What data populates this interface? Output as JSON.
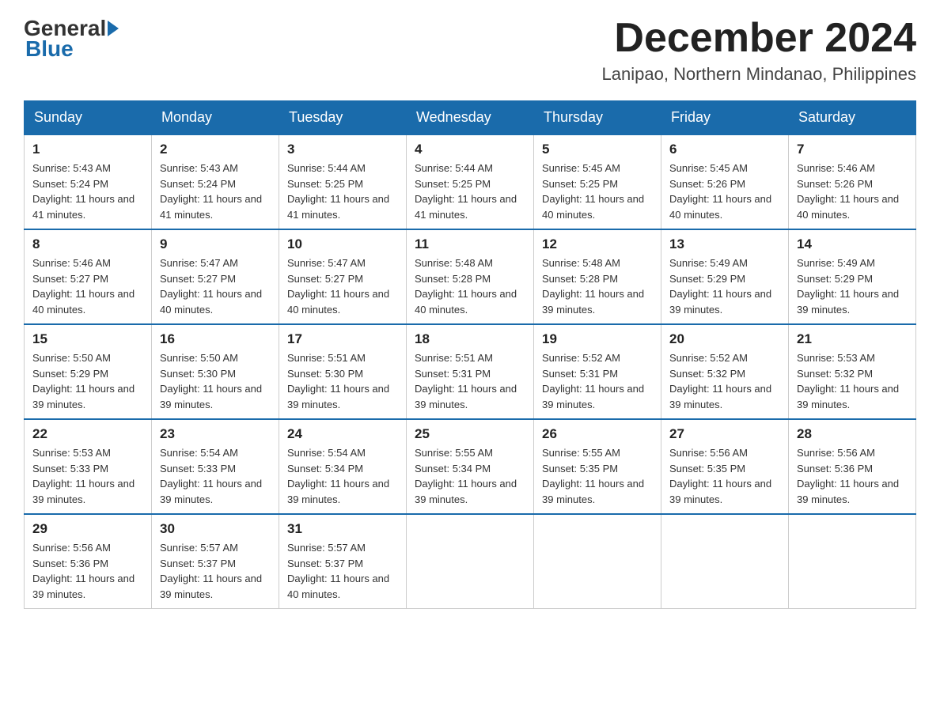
{
  "logo": {
    "general": "General",
    "blue": "Blue"
  },
  "header": {
    "month_year": "December 2024",
    "location": "Lanipao, Northern Mindanao, Philippines"
  },
  "days_of_week": [
    "Sunday",
    "Monday",
    "Tuesday",
    "Wednesday",
    "Thursday",
    "Friday",
    "Saturday"
  ],
  "weeks": [
    [
      {
        "day": "1",
        "sunrise": "5:43 AM",
        "sunset": "5:24 PM",
        "daylight": "11 hours and 41 minutes."
      },
      {
        "day": "2",
        "sunrise": "5:43 AM",
        "sunset": "5:24 PM",
        "daylight": "11 hours and 41 minutes."
      },
      {
        "day": "3",
        "sunrise": "5:44 AM",
        "sunset": "5:25 PM",
        "daylight": "11 hours and 41 minutes."
      },
      {
        "day": "4",
        "sunrise": "5:44 AM",
        "sunset": "5:25 PM",
        "daylight": "11 hours and 41 minutes."
      },
      {
        "day": "5",
        "sunrise": "5:45 AM",
        "sunset": "5:25 PM",
        "daylight": "11 hours and 40 minutes."
      },
      {
        "day": "6",
        "sunrise": "5:45 AM",
        "sunset": "5:26 PM",
        "daylight": "11 hours and 40 minutes."
      },
      {
        "day": "7",
        "sunrise": "5:46 AM",
        "sunset": "5:26 PM",
        "daylight": "11 hours and 40 minutes."
      }
    ],
    [
      {
        "day": "8",
        "sunrise": "5:46 AM",
        "sunset": "5:27 PM",
        "daylight": "11 hours and 40 minutes."
      },
      {
        "day": "9",
        "sunrise": "5:47 AM",
        "sunset": "5:27 PM",
        "daylight": "11 hours and 40 minutes."
      },
      {
        "day": "10",
        "sunrise": "5:47 AM",
        "sunset": "5:27 PM",
        "daylight": "11 hours and 40 minutes."
      },
      {
        "day": "11",
        "sunrise": "5:48 AM",
        "sunset": "5:28 PM",
        "daylight": "11 hours and 40 minutes."
      },
      {
        "day": "12",
        "sunrise": "5:48 AM",
        "sunset": "5:28 PM",
        "daylight": "11 hours and 39 minutes."
      },
      {
        "day": "13",
        "sunrise": "5:49 AM",
        "sunset": "5:29 PM",
        "daylight": "11 hours and 39 minutes."
      },
      {
        "day": "14",
        "sunrise": "5:49 AM",
        "sunset": "5:29 PM",
        "daylight": "11 hours and 39 minutes."
      }
    ],
    [
      {
        "day": "15",
        "sunrise": "5:50 AM",
        "sunset": "5:29 PM",
        "daylight": "11 hours and 39 minutes."
      },
      {
        "day": "16",
        "sunrise": "5:50 AM",
        "sunset": "5:30 PM",
        "daylight": "11 hours and 39 minutes."
      },
      {
        "day": "17",
        "sunrise": "5:51 AM",
        "sunset": "5:30 PM",
        "daylight": "11 hours and 39 minutes."
      },
      {
        "day": "18",
        "sunrise": "5:51 AM",
        "sunset": "5:31 PM",
        "daylight": "11 hours and 39 minutes."
      },
      {
        "day": "19",
        "sunrise": "5:52 AM",
        "sunset": "5:31 PM",
        "daylight": "11 hours and 39 minutes."
      },
      {
        "day": "20",
        "sunrise": "5:52 AM",
        "sunset": "5:32 PM",
        "daylight": "11 hours and 39 minutes."
      },
      {
        "day": "21",
        "sunrise": "5:53 AM",
        "sunset": "5:32 PM",
        "daylight": "11 hours and 39 minutes."
      }
    ],
    [
      {
        "day": "22",
        "sunrise": "5:53 AM",
        "sunset": "5:33 PM",
        "daylight": "11 hours and 39 minutes."
      },
      {
        "day": "23",
        "sunrise": "5:54 AM",
        "sunset": "5:33 PM",
        "daylight": "11 hours and 39 minutes."
      },
      {
        "day": "24",
        "sunrise": "5:54 AM",
        "sunset": "5:34 PM",
        "daylight": "11 hours and 39 minutes."
      },
      {
        "day": "25",
        "sunrise": "5:55 AM",
        "sunset": "5:34 PM",
        "daylight": "11 hours and 39 minutes."
      },
      {
        "day": "26",
        "sunrise": "5:55 AM",
        "sunset": "5:35 PM",
        "daylight": "11 hours and 39 minutes."
      },
      {
        "day": "27",
        "sunrise": "5:56 AM",
        "sunset": "5:35 PM",
        "daylight": "11 hours and 39 minutes."
      },
      {
        "day": "28",
        "sunrise": "5:56 AM",
        "sunset": "5:36 PM",
        "daylight": "11 hours and 39 minutes."
      }
    ],
    [
      {
        "day": "29",
        "sunrise": "5:56 AM",
        "sunset": "5:36 PM",
        "daylight": "11 hours and 39 minutes."
      },
      {
        "day": "30",
        "sunrise": "5:57 AM",
        "sunset": "5:37 PM",
        "daylight": "11 hours and 39 minutes."
      },
      {
        "day": "31",
        "sunrise": "5:57 AM",
        "sunset": "5:37 PM",
        "daylight": "11 hours and 40 minutes."
      },
      null,
      null,
      null,
      null
    ]
  ]
}
